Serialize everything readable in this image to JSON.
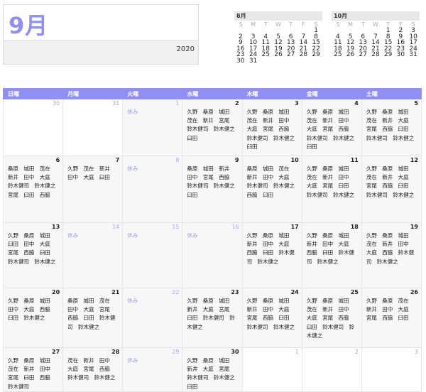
{
  "month_title": "9月",
  "year": "2020",
  "mini_calendars": [
    {
      "title": "8月",
      "weekdays": [
        "S",
        "M",
        "T",
        "W",
        "T",
        "F",
        "S"
      ],
      "weeks": [
        [
          "",
          "",
          "",
          "",
          "",
          "",
          "1"
        ],
        [
          "2",
          "3",
          "4",
          "5",
          "6",
          "7",
          "8"
        ],
        [
          "9",
          "10",
          "11",
          "12",
          "13",
          "14",
          "15"
        ],
        [
          "16",
          "17",
          "18",
          "19",
          "20",
          "21",
          "22"
        ],
        [
          "23",
          "24",
          "25",
          "26",
          "27",
          "28",
          "29"
        ],
        [
          "30",
          "31",
          "",
          "",
          "",
          "",
          ""
        ]
      ]
    },
    {
      "title": "10月",
      "weekdays": [
        "S",
        "M",
        "T",
        "W",
        "T",
        "F",
        "S"
      ],
      "weeks": [
        [
          "",
          "",
          "",
          "",
          "1",
          "2",
          "3"
        ],
        [
          "4",
          "5",
          "6",
          "7",
          "8",
          "9",
          "10"
        ],
        [
          "11",
          "12",
          "13",
          "14",
          "15",
          "16",
          "17"
        ],
        [
          "18",
          "19",
          "20",
          "21",
          "22",
          "23",
          "24"
        ],
        [
          "25",
          "26",
          "27",
          "28",
          "29",
          "30",
          "31"
        ]
      ]
    }
  ],
  "weekday_headers": [
    "日曜",
    "月曜",
    "火曜",
    "水曜",
    "木曜",
    "金曜",
    "土曜"
  ],
  "holiday_label": "休み",
  "weeks": [
    [
      {
        "day": "30",
        "style": "muted",
        "names": ""
      },
      {
        "day": "31",
        "style": "muted",
        "names": ""
      },
      {
        "day": "1",
        "style": "blue",
        "holiday": "休み",
        "names": ""
      },
      {
        "day": "2",
        "style": "",
        "names": "久野 桑原 城田 茂在 新井 宮尾 鈴木健司 鈴木健之 臼田"
      },
      {
        "day": "3",
        "style": "",
        "names": "久野 桑原 城田 茂在 新井 田中 大庭 宮尾 西脇 鈴木健司 鈴木健之 臼田"
      },
      {
        "day": "4",
        "style": "",
        "names": "久野 桑原 城田 茂在 新井 田中 大庭 宮尾 西脇 鈴木健司 鈴木健之 臼田"
      },
      {
        "day": "5",
        "style": "",
        "names": "久野 桑原 城田 茂在 新井 大庭 宮尾 西脇 臼田 鈴木健司 鈴木健之"
      }
    ],
    [
      {
        "day": "6",
        "style": "",
        "names": "桑原 城田 茂在 新井 田中 大庭 鈴木健司 鈴木健之 宮尾 臼田 西脇"
      },
      {
        "day": "7",
        "style": "",
        "names": "久野 茂在 新井 田中 大庭 臼田"
      },
      {
        "day": "8",
        "style": "blue",
        "holiday": "休み",
        "names": ""
      },
      {
        "day": "9",
        "style": "",
        "names": "桑原 城田 新井 田中 宮尾 西脇 鈴木健司 鈴木健之 臼田"
      },
      {
        "day": "10",
        "style": "",
        "names": "桑原 城田 茂在 新井 田中 大庭 鈴木健司 鈴木健之 西脇 臼田"
      },
      {
        "day": "11",
        "style": "",
        "names": "久野 桑原 城田 茂在 新井 田中 大庭 宮尾 臼田 鈴木健司 鈴木健之"
      },
      {
        "day": "12",
        "style": "",
        "names": "久野 桑原 城田 茂在 新井 大庭 宮尾 西脇 臼田 鈴木健司 鈴木健之"
      }
    ],
    [
      {
        "day": "13",
        "style": "",
        "names": "久野 桑原 城田 臼田 田中 大庭 宮尾 西脇 臼田 鈴木健司 鈴木健之"
      },
      {
        "day": "14",
        "style": "blue",
        "holiday": "休み",
        "names": ""
      },
      {
        "day": "15",
        "style": "blue",
        "holiday": "休み",
        "names": ""
      },
      {
        "day": "16",
        "style": "blue",
        "holiday": "休み",
        "names": ""
      },
      {
        "day": "17",
        "style": "",
        "names": "久野 桑原 城田 新井 田中 大庭 西脇 臼田 鈴木健司 鈴木健之"
      },
      {
        "day": "18",
        "style": "",
        "names": "久野 桑原 城田 新井 田中 大庭 西脇 臼田 鈴木健司 鈴木健之"
      },
      {
        "day": "19",
        "style": "",
        "names": "久野 桑原 城田 茂在 新井 田中 大庭 西脇 鈴木健司 鈴木健之"
      }
    ],
    [
      {
        "day": "20",
        "style": "",
        "names": "久野 桑原 城田 田中 大庭 西脇 臼田 鈴木健之"
      },
      {
        "day": "21",
        "style": "",
        "names": "桑原 城田 茂在 田中 大庭 宮尾 西脇 臼田 鈴木健司 鈴木健之"
      },
      {
        "day": "22",
        "style": "blue",
        "holiday": "休み",
        "names": ""
      },
      {
        "day": "23",
        "style": "",
        "names": "久野 桑原 城田 新井 大庭 宮尾 臼田 鈴木健司 鈴木健之"
      },
      {
        "day": "24",
        "style": "",
        "names": "久野 桑原 城田 新井 田中 大庭 宮尾 西脇 臼田 鈴木健司 鈴木健之"
      },
      {
        "day": "25",
        "style": "",
        "names": "久野 桑原 城田 茂在 新井 田中 大庭 宮尾 西脇 臼田 鈴木健司 鈴木健之"
      },
      {
        "day": "26",
        "style": "",
        "names": "久野 桑原 茂在 新井 田中 大庭 宮尾 西脇 臼田"
      }
    ],
    [
      {
        "day": "27",
        "style": "",
        "names": "久野 桑原 城田 茂在 新井 田中 宮尾 臼田 西脇 鈴木健司"
      },
      {
        "day": "28",
        "style": "",
        "names": "茂在 新井 田中 大庭 宮尾 西脇 鈴木健司 鈴木健之"
      },
      {
        "day": "29",
        "style": "blue",
        "holiday": "休み",
        "names": ""
      },
      {
        "day": "30",
        "style": "",
        "names": "久野 桑原 城田 新井 大庭 宮尾 鈴木健司 鈴木健之 臼田"
      },
      {
        "day": "1",
        "style": "muted",
        "names": ""
      },
      {
        "day": "2",
        "style": "muted",
        "names": ""
      },
      {
        "day": "3",
        "style": "muted",
        "names": ""
      }
    ]
  ]
}
